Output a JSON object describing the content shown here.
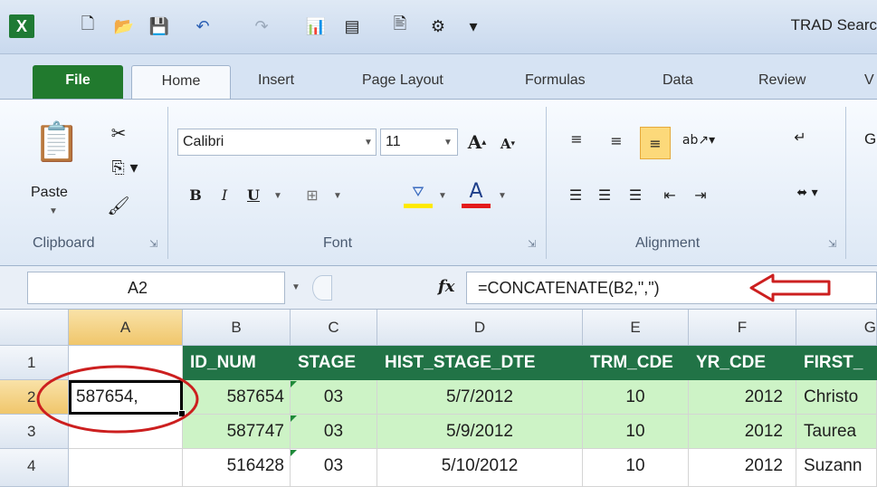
{
  "titlebar": {
    "title": "TRAD Searc"
  },
  "tabs": [
    "File",
    "Home",
    "Insert",
    "Page Layout",
    "Formulas",
    "Data",
    "Review",
    "V"
  ],
  "ribbon": {
    "clipboard": {
      "paste_label": "Paste",
      "group_label": "Clipboard"
    },
    "font": {
      "name": "Calibri",
      "size": "11",
      "bold": "B",
      "italic": "I",
      "underline": "U",
      "group_label": "Font"
    },
    "alignment": {
      "group_label": "Alignment"
    },
    "next_group_letter": "G"
  },
  "formula_bar": {
    "name_box": "A2",
    "fx": "fx",
    "formula": "=CONCATENATE(B2,\",\")"
  },
  "grid": {
    "columns": [
      "A",
      "B",
      "C",
      "D",
      "E",
      "F",
      "G"
    ],
    "rows": [
      "1",
      "2",
      "3",
      "4"
    ],
    "header_row": [
      "ID_NUM",
      "STAGE",
      "HIST_STAGE_DTE",
      "TRM_CDE",
      "YR_CDE",
      "FIRST_"
    ],
    "row2": {
      "A": "587654,",
      "B": "587654",
      "C": "03",
      "D": "5/7/2012",
      "E": "10",
      "F": "2012",
      "G": "Christo"
    },
    "row3": {
      "A": "",
      "B": "587747",
      "C": "03",
      "D": "5/9/2012",
      "E": "10",
      "F": "2012",
      "G": "Taurea"
    },
    "row4": {
      "A": "",
      "B": "516428",
      "C": "03",
      "D": "5/10/2012",
      "E": "10",
      "F": "2012",
      "G": "Suzann"
    }
  },
  "colors": {
    "header_green": "#217346",
    "row_highlight": "#cdf3c6",
    "annotation_red": "#cc1f1f",
    "file_tab": "#217a2e"
  }
}
